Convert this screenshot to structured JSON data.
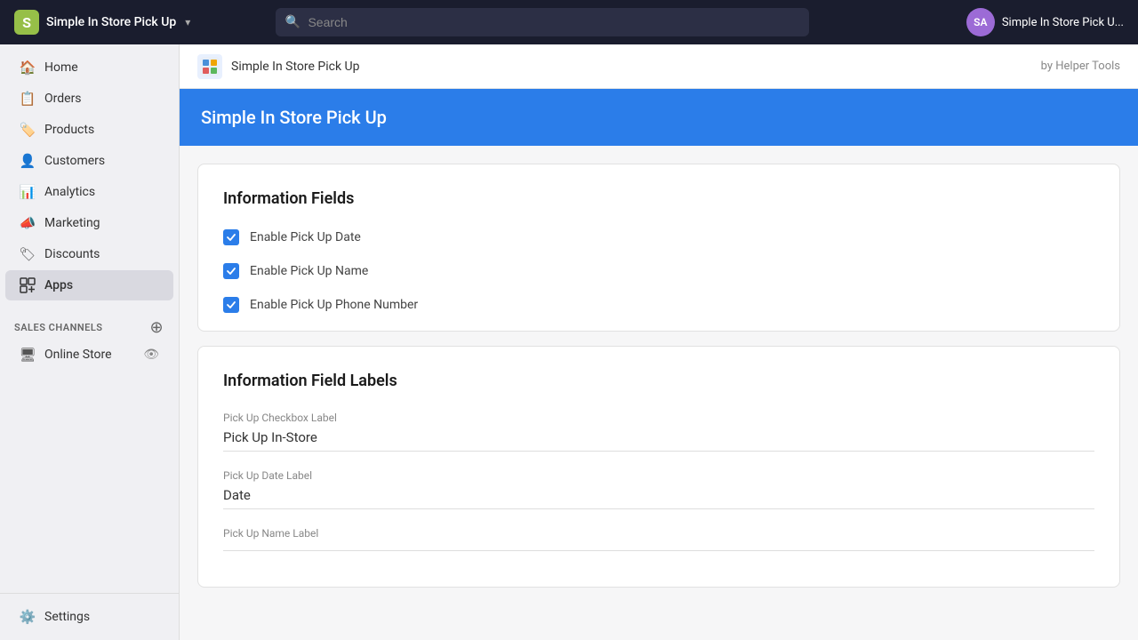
{
  "topNav": {
    "brandName": "Simple In Store Pick Up",
    "searchPlaceholder": "Search",
    "avatarInitials": "SA",
    "storeName": "Simple In Store Pick U..."
  },
  "sidebar": {
    "items": [
      {
        "id": "home",
        "label": "Home",
        "icon": "🏠"
      },
      {
        "id": "orders",
        "label": "Orders",
        "icon": "📋"
      },
      {
        "id": "products",
        "label": "Products",
        "icon": "🏷️"
      },
      {
        "id": "customers",
        "label": "Customers",
        "icon": "👤"
      },
      {
        "id": "analytics",
        "label": "Analytics",
        "icon": "📊"
      },
      {
        "id": "marketing",
        "label": "Marketing",
        "icon": "📣"
      },
      {
        "id": "discounts",
        "label": "Discounts",
        "icon": "🏷"
      },
      {
        "id": "apps",
        "label": "Apps",
        "icon": "⊞",
        "active": true
      }
    ],
    "salesChannelsHeader": "SALES CHANNELS",
    "onlineStore": "Online Store",
    "settings": "Settings"
  },
  "breadcrumb": {
    "appName": "Simple In Store Pick Up",
    "byText": "by Helper Tools"
  },
  "appHeader": {
    "title": "Simple In Store Pick Up"
  },
  "informationFields": {
    "sectionTitle": "Information Fields",
    "checkboxes": [
      {
        "label": "Enable Pick Up Date",
        "checked": true
      },
      {
        "label": "Enable Pick Up Name",
        "checked": true
      },
      {
        "label": "Enable Pick Up Phone Number",
        "checked": true
      }
    ]
  },
  "informationFieldLabels": {
    "sectionTitle": "Information Field Labels",
    "fields": [
      {
        "label": "Pick Up Checkbox Label",
        "value": "Pick Up In-Store"
      },
      {
        "label": "Pick Up Date Label",
        "value": "Date"
      },
      {
        "label": "Pick Up Name Label",
        "value": ""
      }
    ]
  }
}
